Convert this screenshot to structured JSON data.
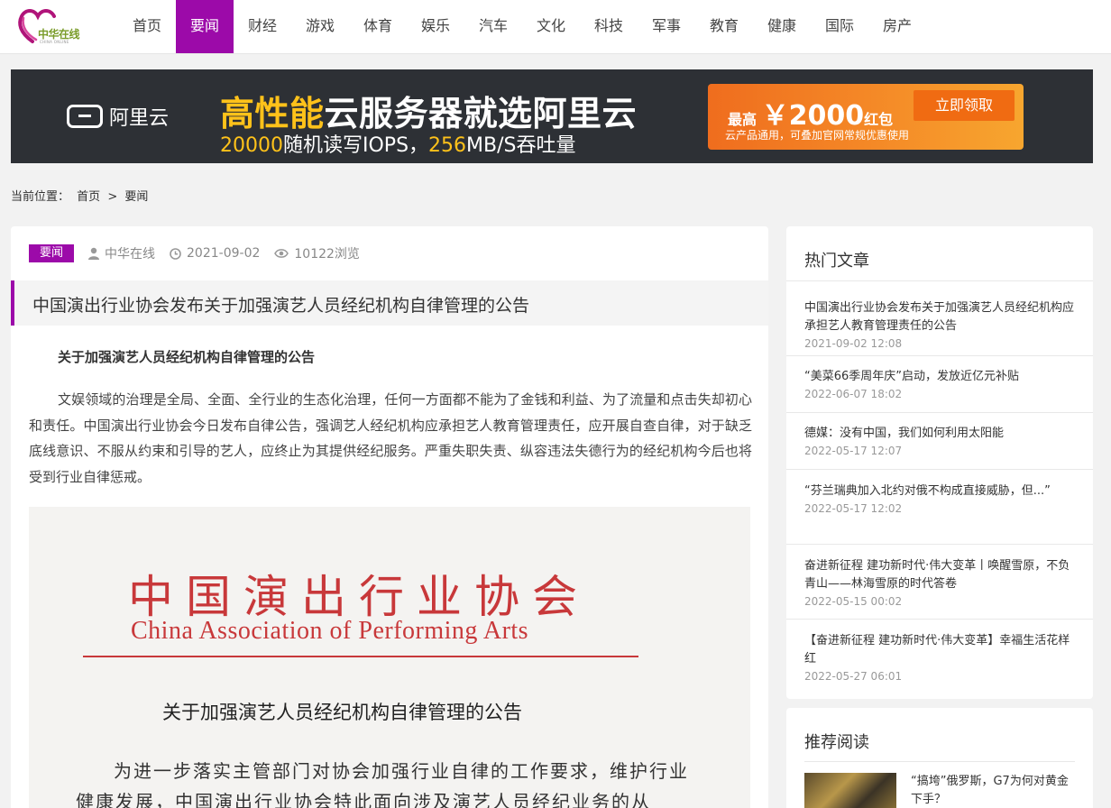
{
  "header": {
    "logo_text": "中华在线",
    "logo_sub": "CHINA ONLINE",
    "nav": [
      {
        "label": "首页"
      },
      {
        "label": "要闻"
      },
      {
        "label": "财经"
      },
      {
        "label": "游戏"
      },
      {
        "label": "体育"
      },
      {
        "label": "娱乐"
      },
      {
        "label": "汽车"
      },
      {
        "label": "文化"
      },
      {
        "label": "科技"
      },
      {
        "label": "军事"
      },
      {
        "label": "教育"
      },
      {
        "label": "健康"
      },
      {
        "label": "国际"
      },
      {
        "label": "房产"
      }
    ],
    "active_nav": "要闻",
    "accent_color": "#9c0aa9"
  },
  "banner": {
    "brand": "阿里云",
    "headline_highlight": "高性能",
    "headline_rest": "云服务器就选阿里云",
    "sub_num1": "20000",
    "sub_text1": "随机读写IOPS，",
    "sub_num2": "256",
    "sub_text2": "MB/S吞吐量",
    "promo_prefix": "最高",
    "promo_amount": "￥2000",
    "promo_suffix": "红包",
    "promo_button": "立即领取",
    "promo_sub": "云产品通用，可叠加官网常规优惠使用"
  },
  "breadcrumb": {
    "prefix": "当前位置：",
    "home": "首页",
    "separator": ">",
    "current": "要闻"
  },
  "article": {
    "tag": "要闻",
    "author": "中华在线",
    "date": "2021-09-02",
    "views": "10122浏览",
    "title": "中国演出行业协会发布关于加强演艺人员经纪机构自律管理的公告",
    "sub_heading": "关于加强演艺人员经纪机构自律管理的公告",
    "body": "文娱领域的治理是全局、全面、全行业的生态化治理，任何一方面都不能为了金钱和利益、为了流量和点击失却初心和责任。中国演出行业协会今日发布自律公告，强调艺人经纪机构应承担艺人教育管理责任，应开展自查自律，对于缺乏底线意识、不服从约束和引导的艺人，应终止为其提供经纪服务。严重失职失责、纵容违法失德行为的经纪机构今后也将受到行业自律惩戒。",
    "doc": {
      "org_cn": "中国演出行业协会",
      "org_en": "China Association of Performing Arts",
      "title": "关于加强演艺人员经纪机构自律管理的公告",
      "para": "为进一步落实主管部门对协会加强行业自律的工作要求，维护行业健康发展，中国演出行业协会特此面向涉及演艺人员经纪业务的从"
    }
  },
  "hot": {
    "title": "热门文章",
    "items": [
      {
        "title": "中国演出行业协会发布关于加强演艺人员经纪机构应承担艺人教育管理责任的公告",
        "date": "2021-09-02 12:08"
      },
      {
        "title": "“美菜66季周年庆”启动，发放近亿元补贴",
        "date": "2022-06-07 18:02"
      },
      {
        "title": "德媒：没有中国，我们如何利用太阳能",
        "date": "2022-05-17 12:07"
      },
      {
        "title": "“芬兰瑞典加入北约对俄不构成直接威胁，但...”",
        "date": "2022-05-17 12:02"
      },
      {
        "title": "奋进新征程 建功新时代·伟大变革丨唤醒雪原，不负青山——林海雪原的时代答卷",
        "date": "2022-05-15 00:02"
      },
      {
        "title": "【奋进新征程 建功新时代·伟大变革】幸福生活花样红",
        "date": "2022-05-27 06:01"
      }
    ]
  },
  "recommend": {
    "title": "推荐阅读",
    "items": [
      {
        "title": "“搞垮”俄罗斯，G7为何对黄金下手？"
      }
    ]
  }
}
